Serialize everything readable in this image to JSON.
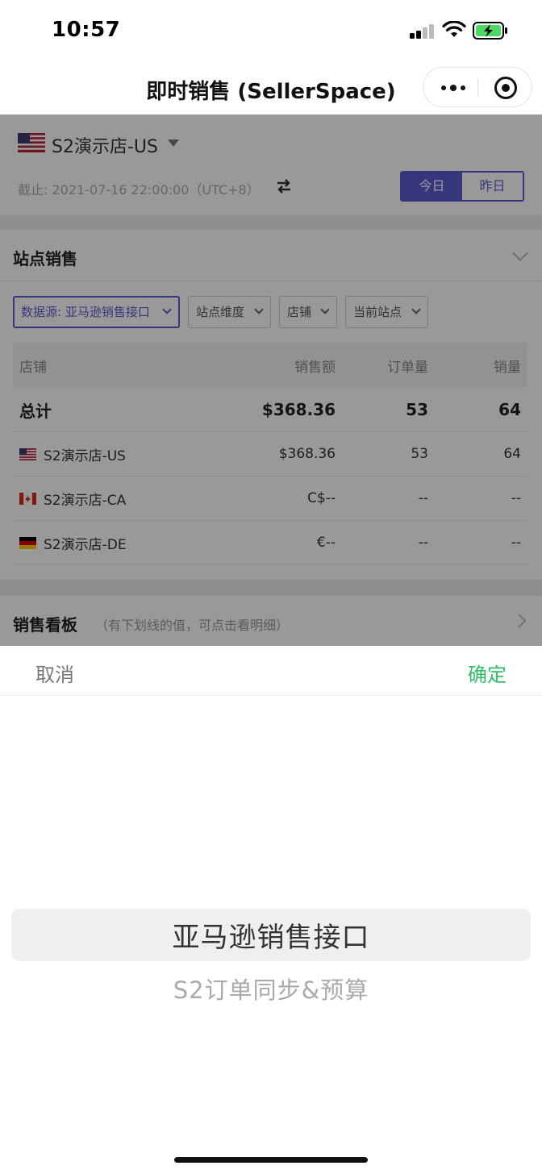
{
  "status_bar": {
    "time": "10:57"
  },
  "nav": {
    "title": "即时销售 (SellerSpace)"
  },
  "store_header": {
    "store_name": "S2演示店-US",
    "cutoff": "截止: 2021-07-16 22:00:00（UTC+8）",
    "toggle": {
      "today": "今日",
      "yesterday": "昨日",
      "selected": "今日"
    }
  },
  "site_sales": {
    "title": "站点销售",
    "filters": [
      "数据源: 亚马逊销售接口",
      "站点维度",
      "店铺",
      "当前站点"
    ],
    "table": {
      "headers": [
        "店铺",
        "销售额",
        "订单量",
        "销量"
      ],
      "total": {
        "label": "总计",
        "sales": "$368.36",
        "orders": "53",
        "qty": "64"
      },
      "rows": [
        {
          "flag": "us-flag-icon",
          "store": "S2演示店-US",
          "sales": "$368.36",
          "orders": "53",
          "qty": "64"
        },
        {
          "flag": "ca-flag-icon",
          "store": "S2演示店-CA",
          "sales": "C$--",
          "orders": "--",
          "qty": "--"
        },
        {
          "flag": "de-flag-icon",
          "store": "S2演示店-DE",
          "sales": "€--",
          "orders": "--",
          "qty": "--"
        }
      ]
    }
  },
  "dashboard": {
    "title": "销售看板",
    "note": "（有下划线的值，可点击看明细）"
  },
  "picker": {
    "cancel": "取消",
    "confirm": "确定",
    "options": [
      "亚马逊销售接口",
      "S2订单同步&预算"
    ],
    "selected": "亚马逊销售接口"
  },
  "colors": {
    "accent": "#5d5ad0",
    "confirm": "#2fbe64"
  }
}
